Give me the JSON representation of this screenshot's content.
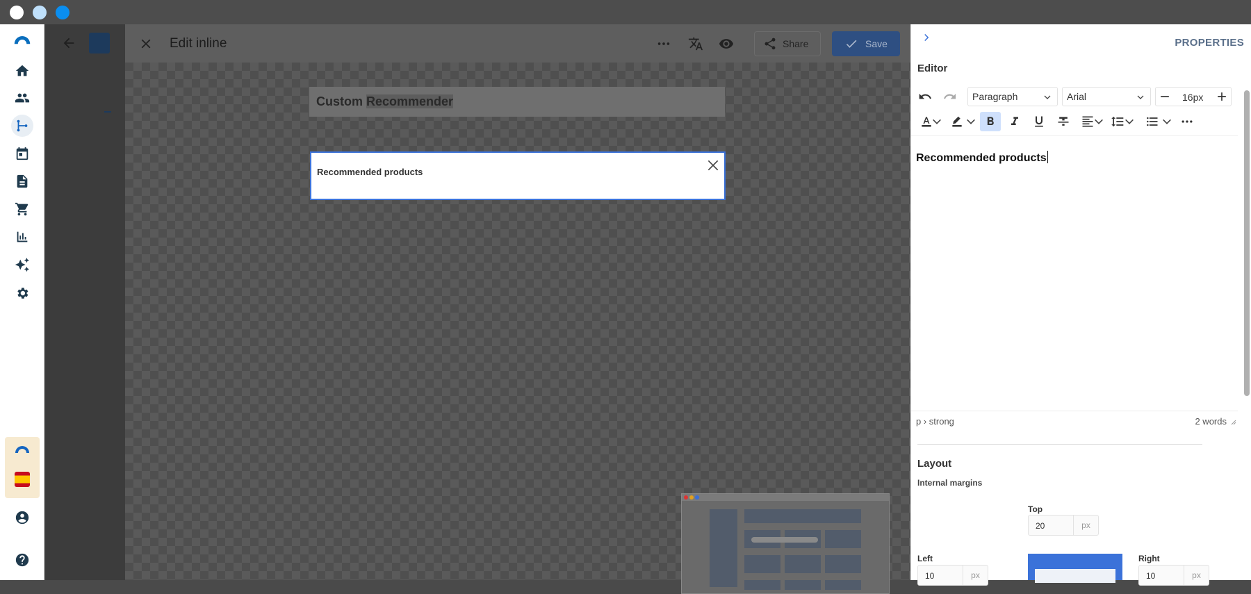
{
  "window": {
    "controls": [
      "close",
      "minimize",
      "zoom"
    ]
  },
  "nav": {
    "items": [
      "home-icon",
      "users-icon",
      "journey-icon",
      "calendar-icon",
      "document-icon",
      "cart-icon",
      "chart-icon",
      "sparkle-icon",
      "gear-icon"
    ],
    "active": "journey-icon",
    "flag": "es"
  },
  "modal": {
    "title": "Edit inline",
    "share_label": "Share",
    "save_label": "Save",
    "accent": "#2e4f82"
  },
  "canvas": {
    "header_text_a": "Custom",
    "header_text_b": "Recommender",
    "block_text": "Recommended products"
  },
  "panel": {
    "title": "PROPERTIES",
    "editor_label": "Editor",
    "block_format": "Paragraph",
    "font_family": "Arial",
    "font_size": "16px",
    "content": "Recommended products",
    "path": "p › strong",
    "word_count": "2 words",
    "layout_label": "Layout",
    "margins_label": "Internal margins",
    "top_label": "Top",
    "top_value": "20",
    "left_label": "Left",
    "left_value": "10",
    "right_label": "Right",
    "right_value": "10",
    "unit": "px"
  }
}
